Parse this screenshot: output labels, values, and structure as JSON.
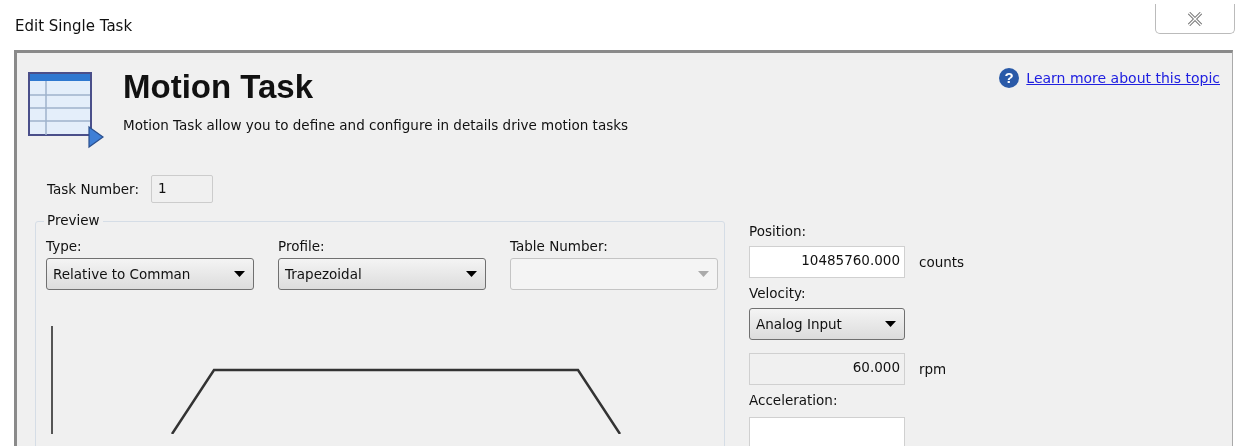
{
  "window": {
    "title": "Edit Single Task"
  },
  "header": {
    "title": "Motion Task",
    "description": "Motion Task allow you to define and configure in details drive motion tasks",
    "help_icon": "?",
    "help_link": "Learn more about this topic"
  },
  "task_number": {
    "label": "Task Number:",
    "value": "1"
  },
  "preview": {
    "title": "Preview",
    "dropdowns": [
      {
        "label": "Type:",
        "value": "Relative to Comman",
        "disabled": false
      },
      {
        "label": "Profile:",
        "value": "Trapezoidal",
        "disabled": false
      },
      {
        "label": "Table Number:",
        "disabled": true
      }
    ]
  },
  "position": {
    "label": "Position:",
    "value": "10485760.000",
    "unit": "counts"
  },
  "velocity": {
    "label": "Velocity:",
    "source": "Analog Input",
    "value": "60.000",
    "unit": "rpm"
  },
  "acceleration": {
    "label": "Acceleration:"
  }
}
